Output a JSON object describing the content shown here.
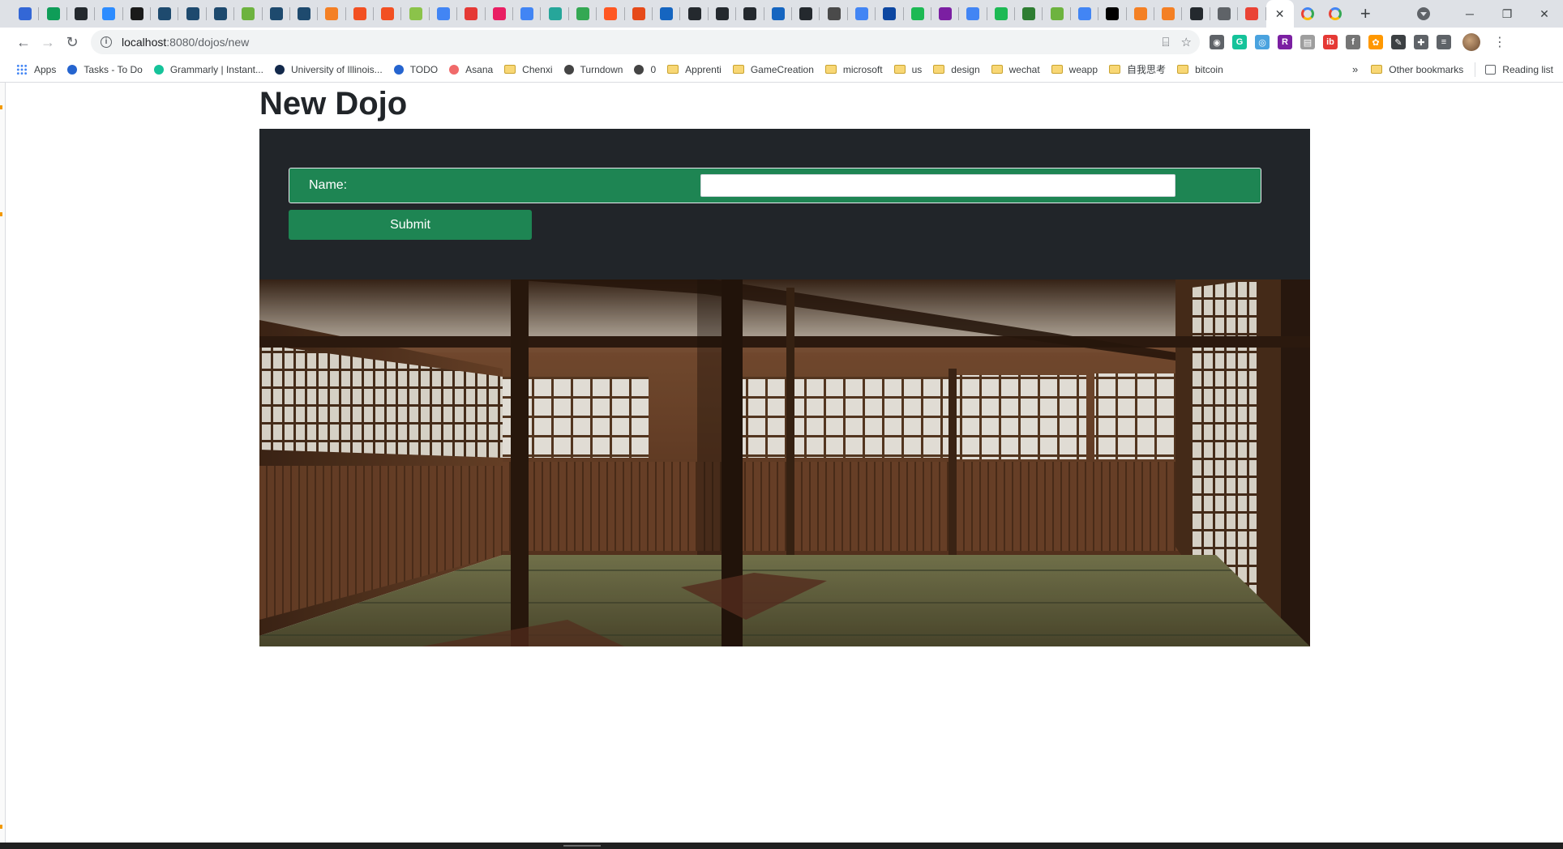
{
  "browser": {
    "tabs": {
      "favicon_colors": [
        "#3367d6",
        "#0f9d58",
        "#24292e",
        "#2d8cff",
        "#1a1a1a",
        "#1e4a6e",
        "#1e4a6e",
        "#1e4a6e",
        "#6db33f",
        "#1e4a6e",
        "#1e4a6e",
        "#f48024",
        "#f25022",
        "#f25022",
        "#8bc34a",
        "#4285f4",
        "#e53935",
        "#e91e63",
        "#4285f4",
        "#26a69a",
        "#34a853",
        "#ff5722",
        "#e64a19",
        "#1565c0",
        "#24292e",
        "#24292e",
        "#24292e",
        "#1565c0",
        "#24292e",
        "#4a4a4a",
        "#4285f4",
        "#0d47a1",
        "#1db954",
        "#7b1fa2",
        "#4285f4",
        "#1db954",
        "#2e7d32",
        "#6db33f",
        "#4285f4",
        "#000000",
        "#f48024",
        "#f48024",
        "#24292e",
        "#5f6368",
        "#ea4335"
      ],
      "active_tab_close": "✕",
      "trailing_google_tabs": 2,
      "new_tab": "+"
    },
    "window_controls": {
      "minimize": "─",
      "restore": "❐",
      "close": "✕"
    },
    "toolbar": {
      "back": "←",
      "forward": "→",
      "reload": "↻",
      "url_host": "localhost",
      "url_path": ":8080/dojos/new",
      "omnibox_icons": [
        "translate-icon",
        "bookmark-star-icon"
      ]
    },
    "extensions": [
      {
        "name": "camera-icon",
        "color": "#5f6368",
        "glyph": "◉"
      },
      {
        "name": "grammarly-icon",
        "color": "#15c39a",
        "glyph": "G"
      },
      {
        "name": "blue-ext-icon",
        "color": "#4aa3df",
        "glyph": "◎"
      },
      {
        "name": "r-ext-icon",
        "color": "#7b1fa2",
        "glyph": "R"
      },
      {
        "name": "gray-ext-icon",
        "color": "#9e9e9e",
        "glyph": "▤"
      },
      {
        "name": "ib-ext-icon",
        "color": "#e53935",
        "glyph": "ib"
      },
      {
        "name": "f-ext-icon",
        "color": "#757575",
        "glyph": "f"
      },
      {
        "name": "color-wheel-icon",
        "color": "#ff9800",
        "glyph": "✿"
      },
      {
        "name": "quill-ext-icon",
        "color": "#3c4043",
        "glyph": "✎"
      },
      {
        "name": "puzzle-icon",
        "color": "#5f6368",
        "glyph": "✚"
      },
      {
        "name": "media-icon",
        "color": "#5f6368",
        "glyph": "≡"
      }
    ],
    "bookmarks": [
      {
        "label": "Apps",
        "icon": "apps-grid-icon"
      },
      {
        "label": "Tasks - To Do",
        "icon": "check-icon",
        "color": "#2564cf"
      },
      {
        "label": "Grammarly | Instant...",
        "icon": "grammarly-icon",
        "color": "#15c39a"
      },
      {
        "label": "University of Illinois...",
        "icon": "sun-icon",
        "color": "#13294b"
      },
      {
        "label": "TODO",
        "icon": "check-icon",
        "color": "#2564cf"
      },
      {
        "label": "Asana",
        "icon": "asana-icon",
        "color": "#f06a6a"
      },
      {
        "label": "Chenxi",
        "icon": "folder-icon"
      },
      {
        "label": "Turndown",
        "icon": "turndown-icon",
        "color": "#444"
      },
      {
        "label": "0",
        "icon": "link-icon",
        "color": "#444"
      },
      {
        "label": "Apprenti",
        "icon": "folder-icon"
      },
      {
        "label": "GameCreation",
        "icon": "folder-icon"
      },
      {
        "label": "microsoft",
        "icon": "folder-icon"
      },
      {
        "label": "us",
        "icon": "folder-icon"
      },
      {
        "label": "design",
        "icon": "folder-icon"
      },
      {
        "label": "wechat",
        "icon": "folder-icon"
      },
      {
        "label": "weapp",
        "icon": "folder-icon"
      },
      {
        "label": "自我思考",
        "icon": "folder-icon"
      },
      {
        "label": "bitcoin",
        "icon": "folder-icon"
      }
    ],
    "bookmarks_overflow": "»",
    "other_bookmarks": "Other bookmarks",
    "reading_list": "Reading list"
  },
  "page": {
    "title": "New Dojo",
    "form": {
      "name_label": "Name:",
      "name_value": "",
      "submit_label": "Submit"
    },
    "colors": {
      "panel_bg": "#212529",
      "form_green": "#1e8553"
    }
  }
}
